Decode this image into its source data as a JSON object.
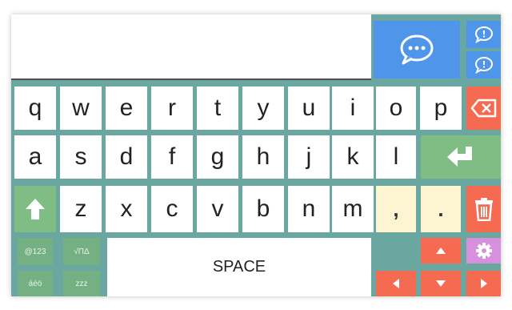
{
  "keyboard": {
    "row1": [
      "q",
      "w",
      "e",
      "r",
      "t",
      "y",
      "u",
      "i",
      "o",
      "p"
    ],
    "row2": [
      "a",
      "s",
      "d",
      "f",
      "g",
      "h",
      "j",
      "k",
      "l"
    ],
    "row3": [
      "z",
      "x",
      "c",
      "v",
      "b",
      "n",
      "m"
    ],
    "punct": [
      ",",
      "."
    ],
    "mode_keys": [
      "@123",
      "√ΠΔ",
      "áéö",
      "zzz"
    ],
    "space_label": "SPACE"
  },
  "colors": {
    "background": "#6aa7a1",
    "letter_key": "#ffffff",
    "mode_key": "#74b081",
    "punct_key": "#fdf5d2",
    "action_orange": "#f56b52",
    "enter_green": "#7fbd84",
    "speak_blue": "#4f95ea",
    "settings_purple": "#d690dd"
  },
  "icons": {
    "speak": "speech-bubble-icon",
    "phrase1": "speech-bubble-icon",
    "phrase2": "speech-bubble-icon",
    "backspace": "backspace-icon",
    "enter": "enter-icon",
    "shift": "shift-arrow-icon",
    "delete": "trash-icon",
    "settings": "gear-icon",
    "up": "arrow-up-icon",
    "left": "arrow-left-icon",
    "down": "arrow-down-icon",
    "right": "arrow-right-icon"
  }
}
